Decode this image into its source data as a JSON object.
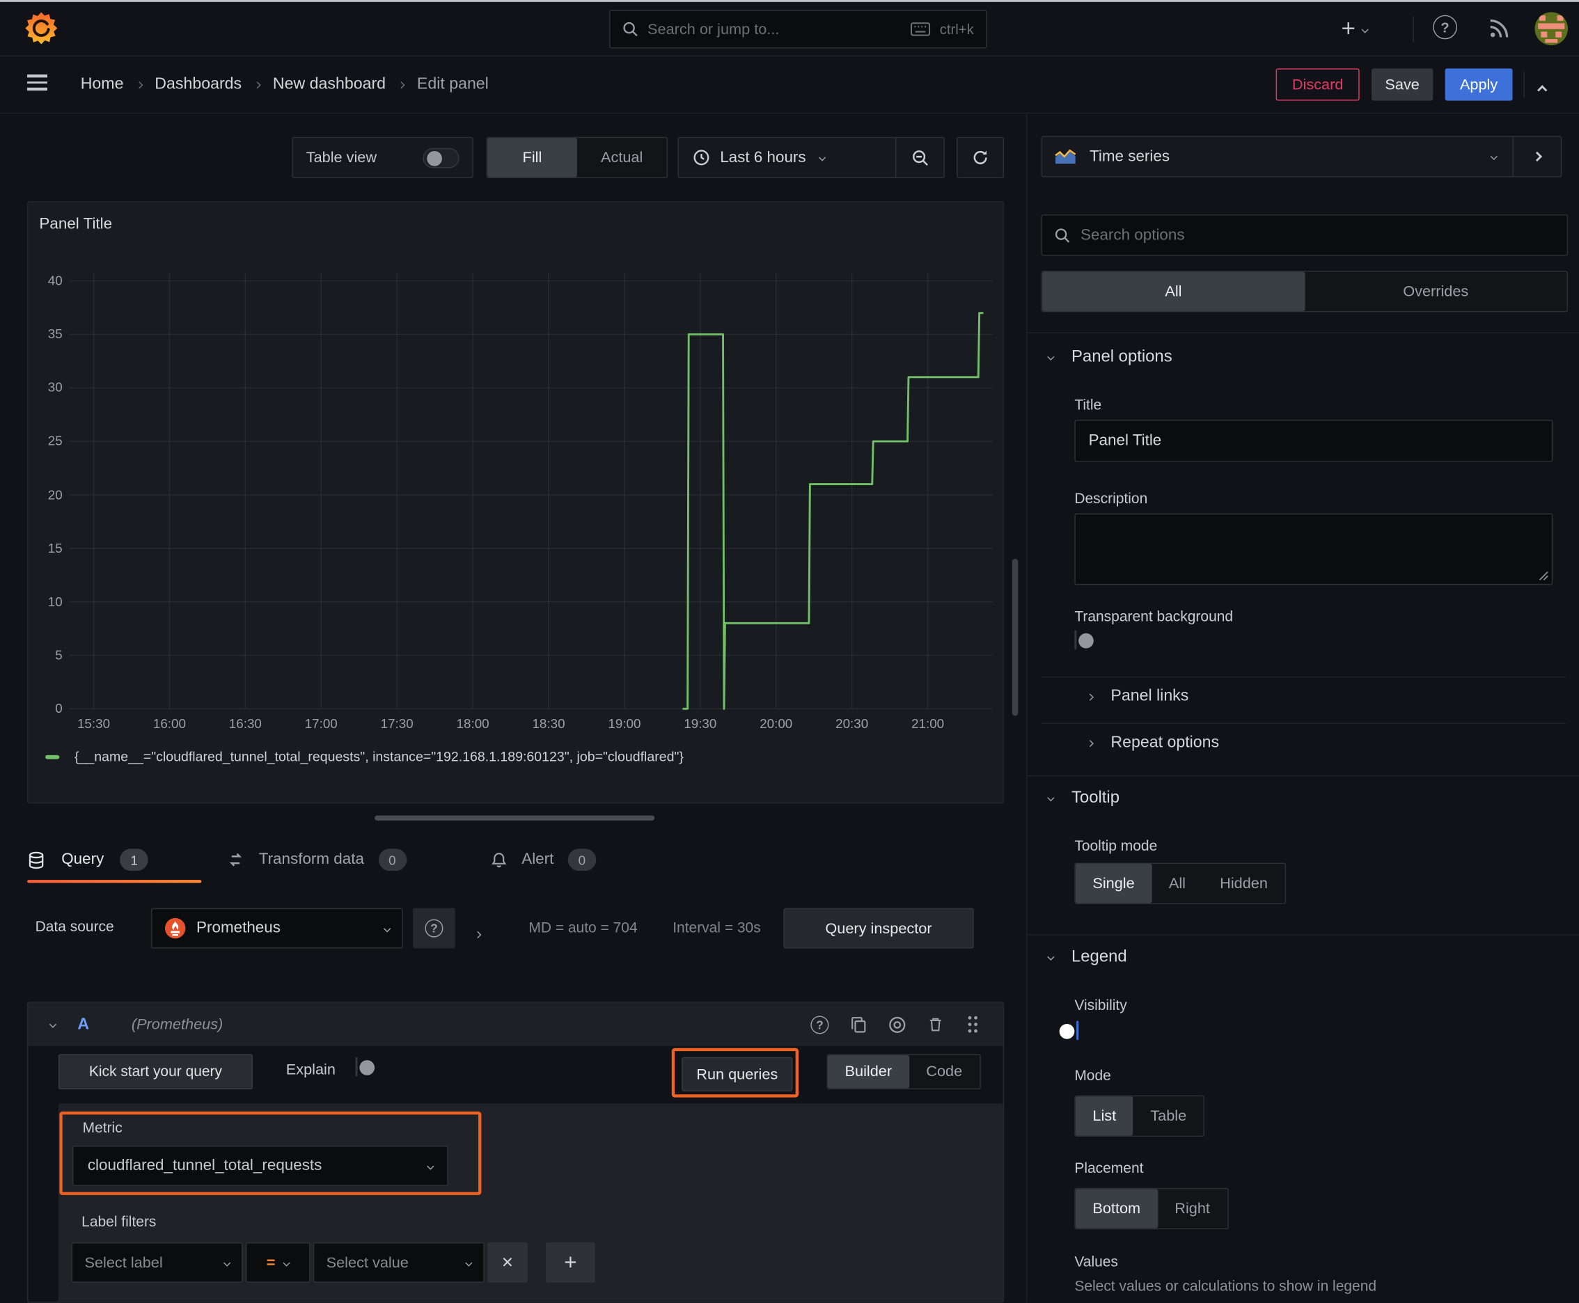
{
  "topbar": {
    "search_placeholder": "Search or jump to...",
    "shortcut": "ctrl+k"
  },
  "breadcrumb": {
    "items": [
      "Home",
      "Dashboards",
      "New dashboard",
      "Edit panel"
    ]
  },
  "header_actions": {
    "discard": "Discard",
    "save": "Save",
    "apply": "Apply"
  },
  "panel_toolbar": {
    "table_view": "Table view",
    "fill": "Fill",
    "actual": "Actual",
    "time_range": "Last 6 hours"
  },
  "viz_picker": {
    "label": "Time series"
  },
  "panel": {
    "title": "Panel Title"
  },
  "chart_data": {
    "type": "line",
    "line_style": "step",
    "title": "Panel Title",
    "x_ticks": [
      "15:30",
      "16:00",
      "16:30",
      "17:00",
      "17:30",
      "18:00",
      "18:30",
      "19:00",
      "19:30",
      "20:00",
      "20:30",
      "21:00"
    ],
    "x_tick_start_minute": 930,
    "x_tick_step_minutes": 30,
    "y_ticks": [
      0,
      5,
      10,
      15,
      20,
      25,
      30,
      35,
      40
    ],
    "ylim": [
      0,
      40
    ],
    "grid": true,
    "legend_position": "bottom",
    "series": [
      {
        "name": "{__name__=\"cloudflared_tunnel_total_requests\", instance=\"192.168.1.189:60123\", job=\"cloudflared\"}",
        "color": "#73BF69",
        "points_minute_value": [
          [
            1163,
            0
          ],
          [
            1165,
            0
          ],
          [
            1165.4,
            35
          ],
          [
            1179,
            35
          ],
          [
            1179.4,
            0
          ],
          [
            1179.8,
            8
          ],
          [
            1213,
            8
          ],
          [
            1213.4,
            21
          ],
          [
            1238,
            21
          ],
          [
            1238.4,
            25
          ],
          [
            1252,
            25
          ],
          [
            1252.4,
            31
          ],
          [
            1280,
            31
          ],
          [
            1280.4,
            37
          ],
          [
            1282,
            37
          ]
        ]
      }
    ]
  },
  "query_tabs": [
    {
      "label": "Query",
      "badge": "1"
    },
    {
      "label": "Transform data",
      "badge": "0"
    },
    {
      "label": "Alert",
      "badge": "0"
    }
  ],
  "datasource_row": {
    "label": "Data source",
    "datasource": "Prometheus",
    "stats_md": "MD = auto = 704",
    "stats_interval": "Interval = 30s",
    "query_inspector": "Query inspector"
  },
  "query_editor": {
    "ref_id": "A",
    "datasource_hint": "(Prometheus)",
    "kick_start": "Kick start your query",
    "explain": "Explain",
    "run_queries": "Run queries",
    "builder": "Builder",
    "code": "Code",
    "metric_label": "Metric",
    "metric_value": "cloudflared_tunnel_total_requests",
    "label_filters_label": "Label filters",
    "select_label_placeholder": "Select label",
    "operator": "=",
    "select_value_placeholder": "Select value"
  },
  "options_pane": {
    "search_placeholder": "Search options",
    "tabs": {
      "all": "All",
      "overrides": "Overrides"
    },
    "panel_options": {
      "header": "Panel options",
      "title_label": "Title",
      "title_value": "Panel Title",
      "description_label": "Description",
      "transparent_label": "Transparent background",
      "panel_links": "Panel links",
      "repeat_options": "Repeat options"
    },
    "tooltip": {
      "header": "Tooltip",
      "mode_label": "Tooltip mode",
      "modes": [
        "Single",
        "All",
        "Hidden"
      ]
    },
    "legend": {
      "header": "Legend",
      "visibility_label": "Visibility",
      "mode_label": "Mode",
      "modes": [
        "List",
        "Table"
      ],
      "placement_label": "Placement",
      "placements": [
        "Bottom",
        "Right"
      ],
      "values_label": "Values",
      "values_hint": "Select values or calculations to show in legend"
    }
  },
  "colors": {
    "series_green": "#73BF69",
    "highlight_orange": "#EE6223",
    "primary_blue": "#3D71D9",
    "destructive_red": "#E23A67",
    "tab_underline_from": "#F55F3C",
    "tab_underline_to": "#FF8837"
  }
}
